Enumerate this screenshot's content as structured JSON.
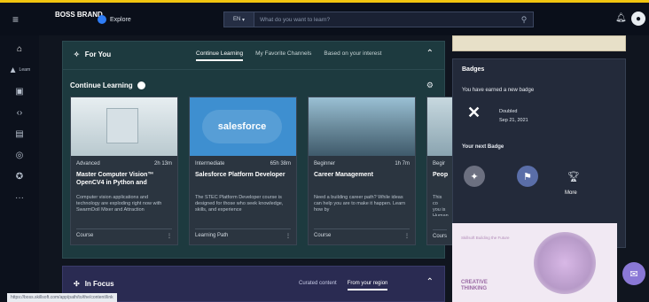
{
  "header": {
    "logo": "BOSS BRAND",
    "explore_label": "Explore",
    "language": "EN",
    "search_placeholder": "What do you want to learn?"
  },
  "nav": {
    "items": [
      {
        "icon": "home-icon",
        "label": ""
      },
      {
        "icon": "learn-icon",
        "label": "Learn"
      },
      {
        "icon": "briefcase-icon",
        "label": ""
      },
      {
        "icon": "code-icon",
        "label": ""
      },
      {
        "icon": "chat-icon",
        "label": ""
      },
      {
        "icon": "compass-icon",
        "label": ""
      },
      {
        "icon": "globe-icon",
        "label": ""
      },
      {
        "icon": "more-icon",
        "label": ""
      }
    ]
  },
  "for_you": {
    "title": "For You",
    "tabs": [
      "Continue Learning",
      "My Favorite Channels",
      "Based on your interest"
    ],
    "active_tab": 0,
    "section_title": "Continue Learning"
  },
  "cards": [
    {
      "level": "Advanced",
      "duration": "2h 13m",
      "title": "Master Computer Vision™ OpenCV4 in Python and",
      "description": "Computer vision applications and technology are exploding right now with SwarmDoll Mixer and Attraction",
      "type": "Course"
    },
    {
      "level": "Intermediate",
      "duration": "65h 38m",
      "title": "Salesforce Platform Developer",
      "description": "The STEC Platform Developer course is designed for those who seek knowledge, skills, and experience",
      "type": "Learning Path",
      "logo_text": "salesforce"
    },
    {
      "level": "Beginner",
      "duration": "1h 7m",
      "title": "Career Management",
      "description": "Need a building career path? While ideas can help you are to make it happen. Learn how by",
      "type": "Course"
    },
    {
      "level": "Begir",
      "duration": "",
      "title": "Peop",
      "description": "This co you is Human",
      "type": "Cours"
    }
  ],
  "in_focus": {
    "title": "In Focus",
    "tabs": [
      "Curated content",
      "From your region"
    ],
    "active_tab": 1
  },
  "url_tooltip": "https://boss.skillsoft.com/app/path/to/the/content/link",
  "badges": {
    "title": "Badges",
    "subtitle": "You have earned a new badge",
    "status": "Doubled",
    "date": "Sep 21, 2021",
    "next_title": "Your next Badge",
    "more_label": "More"
  },
  "promo": {
    "small_text": "Skillsoft Building the Future",
    "headline_1": "CREATIVE",
    "headline_2": "THINKING"
  }
}
